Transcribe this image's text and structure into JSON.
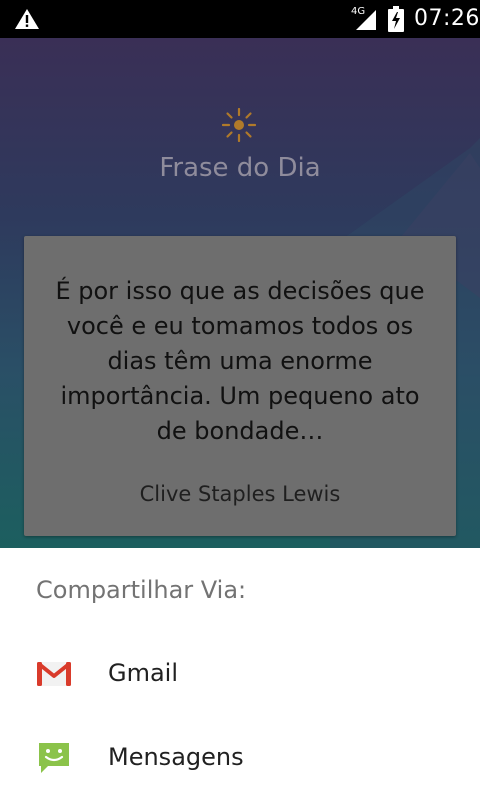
{
  "status_bar": {
    "network": "4G",
    "time": "07:26",
    "icons": [
      "warning-icon",
      "signal-icon",
      "battery-charging-icon"
    ]
  },
  "app": {
    "title": "Frase do Dia",
    "icon": "sun-icon",
    "quote": {
      "text": "É por isso que as decisões que você e eu tomamos todos os dias têm uma enorme importância. Um pequeno ato de bondade…",
      "author": "Clive Staples Lewis"
    }
  },
  "share_sheet": {
    "title": "Compartilhar Via:",
    "items": [
      {
        "label": "Gmail",
        "icon": "gmail-icon"
      },
      {
        "label": "Mensagens",
        "icon": "messages-icon"
      }
    ]
  },
  "colors": {
    "status_bar": "#000000",
    "app_gradient_top": "#3a2f56",
    "app_gradient_bottom": "#1c5f5f",
    "sun_accent": "#b07a2a",
    "card": "#6e6e6e",
    "share_title": "#737373",
    "gmail_red": "#d93b2b",
    "messages_green": "#8bc34a"
  }
}
